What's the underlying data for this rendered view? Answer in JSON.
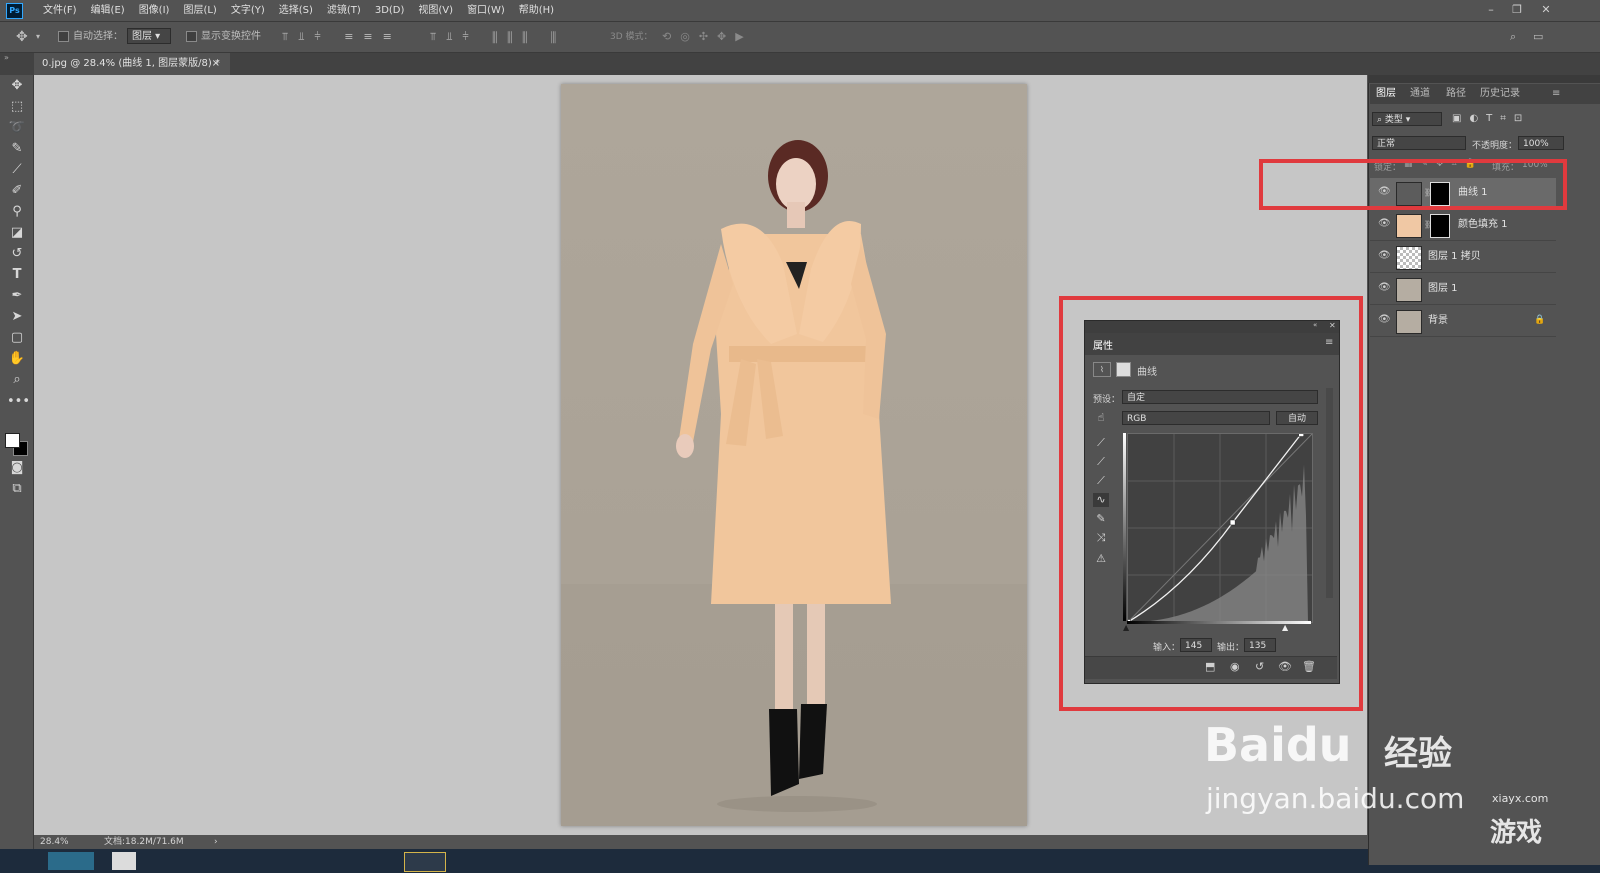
{
  "app": {
    "logo": "Ps"
  },
  "menu": [
    "文件(F)",
    "编辑(E)",
    "图像(I)",
    "图层(L)",
    "文字(Y)",
    "选择(S)",
    "滤镜(T)",
    "3D(D)",
    "视图(V)",
    "窗口(W)",
    "帮助(H)"
  ],
  "options": {
    "auto_select_label": "自动选择：",
    "auto_select_value": "图层",
    "show_transform_label": "显示变换控件",
    "mode_3d_label": "3D 模式："
  },
  "document_tab": {
    "title": "0.jpg @ 28.4% (曲线 1, 图层蒙版/8) *",
    "close": "×"
  },
  "status": {
    "zoom": "28.4%",
    "doc_info": "文档:18.2M/71.6M"
  },
  "layers_panel": {
    "tabs": [
      "图层",
      "通道",
      "路径",
      "历史记录"
    ],
    "filter_label": "类型",
    "blend_mode": "正常",
    "opacity_label": "不透明度：",
    "opacity_value": "100%",
    "lock_label": "锁定：",
    "fill_label": "填充：",
    "fill_value": "100%",
    "layers": [
      {
        "name": "曲线 1",
        "selected": true
      },
      {
        "name": "颜色填充 1"
      },
      {
        "name": "图层 1 拷贝"
      },
      {
        "name": "图层 1"
      },
      {
        "name": "背景",
        "locked": true
      }
    ]
  },
  "properties_panel": {
    "title": "属性",
    "type_label": "曲线",
    "preset_label": "预设：",
    "preset_value": "自定",
    "channel_value": "RGB",
    "auto_button": "自动",
    "input_label": "输入：",
    "input_value": "145",
    "output_label": "输出：",
    "output_value": "135"
  },
  "curve": {
    "points": [
      [
        0,
        0
      ],
      [
        145,
        135
      ],
      [
        240,
        255
      ]
    ],
    "range": [
      0,
      255
    ]
  },
  "highlight_color": "#e03a3e",
  "watermark": {
    "brand": "Baidu",
    "brand_cn": "经验",
    "url": "jingyan.baidu.com",
    "corner_text": "游戏",
    "corner_url": "xiayx.com"
  }
}
